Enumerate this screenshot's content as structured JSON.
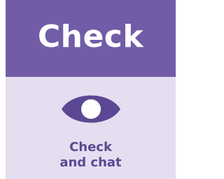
{
  "card": {
    "title": "Check",
    "icon": "eye-icon",
    "caption_line1": "Check",
    "caption_line2": "and chat"
  },
  "colors": {
    "header_bg": "#725ca7",
    "body_bg": "#e4def0",
    "accent": "#5c4794",
    "title_text": "#ffffff"
  }
}
